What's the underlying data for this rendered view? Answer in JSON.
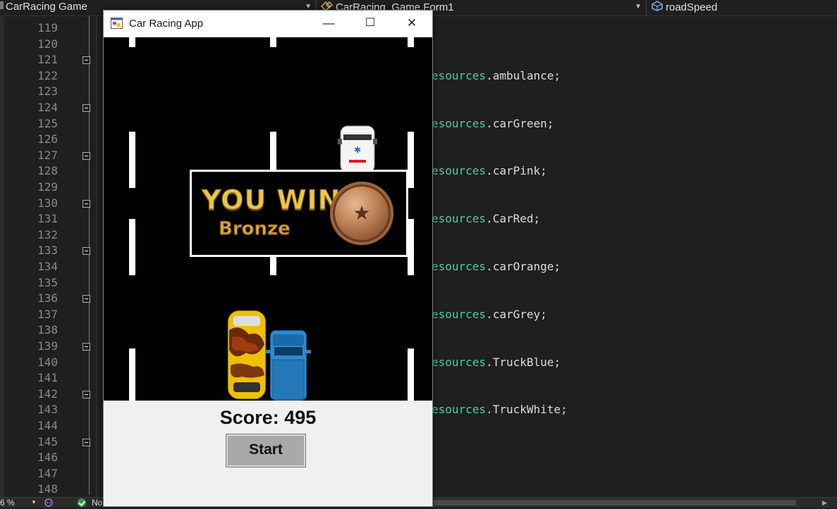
{
  "ide": {
    "project_combo": "CarRacing Game",
    "class_combo": "CarRacing_Game.Form1",
    "member_combo": "roadSpeed",
    "line_numbers": [
      "119",
      "120",
      "121",
      "122",
      "123",
      "124",
      "125",
      "126",
      "127",
      "128",
      "129",
      "130",
      "131",
      "132",
      "133",
      "134",
      "135",
      "136",
      "137",
      "138",
      "139",
      "140",
      "141",
      "142",
      "143",
      "144",
      "145",
      "146",
      "147",
      "148"
    ],
    "code_lines": [
      {
        "line": "122",
        "prefix": "esources",
        "suffix": ".ambulance;"
      },
      {
        "line": "125",
        "prefix": "esources",
        "suffix": ".carGreen;"
      },
      {
        "line": "128",
        "prefix": "esources",
        "suffix": ".carPink;"
      },
      {
        "line": "131",
        "prefix": "esources",
        "suffix": ".CarRed;"
      },
      {
        "line": "134",
        "prefix": "esources",
        "suffix": ".carOrange;"
      },
      {
        "line": "137",
        "prefix": "esources",
        "suffix": ".carGrey;"
      },
      {
        "line": "140",
        "prefix": "esources",
        "suffix": ".TruckBlue;"
      },
      {
        "line": "143",
        "prefix": "esources",
        "suffix": ".TruckWhite;"
      }
    ],
    "status": {
      "zoom": "6 %",
      "text": "No"
    }
  },
  "app": {
    "title": "Car Racing App",
    "minimize_glyph": "—",
    "maximize_glyph": "☐",
    "close_glyph": "✕",
    "win_text": "YOU WIN",
    "award_text": "Bronze",
    "score_label": "Score: 495",
    "start_label": "Start"
  },
  "colors": {
    "accent_teal": "#4ec9b0",
    "road": "#000000",
    "form_bg": "#f0f0f0"
  }
}
